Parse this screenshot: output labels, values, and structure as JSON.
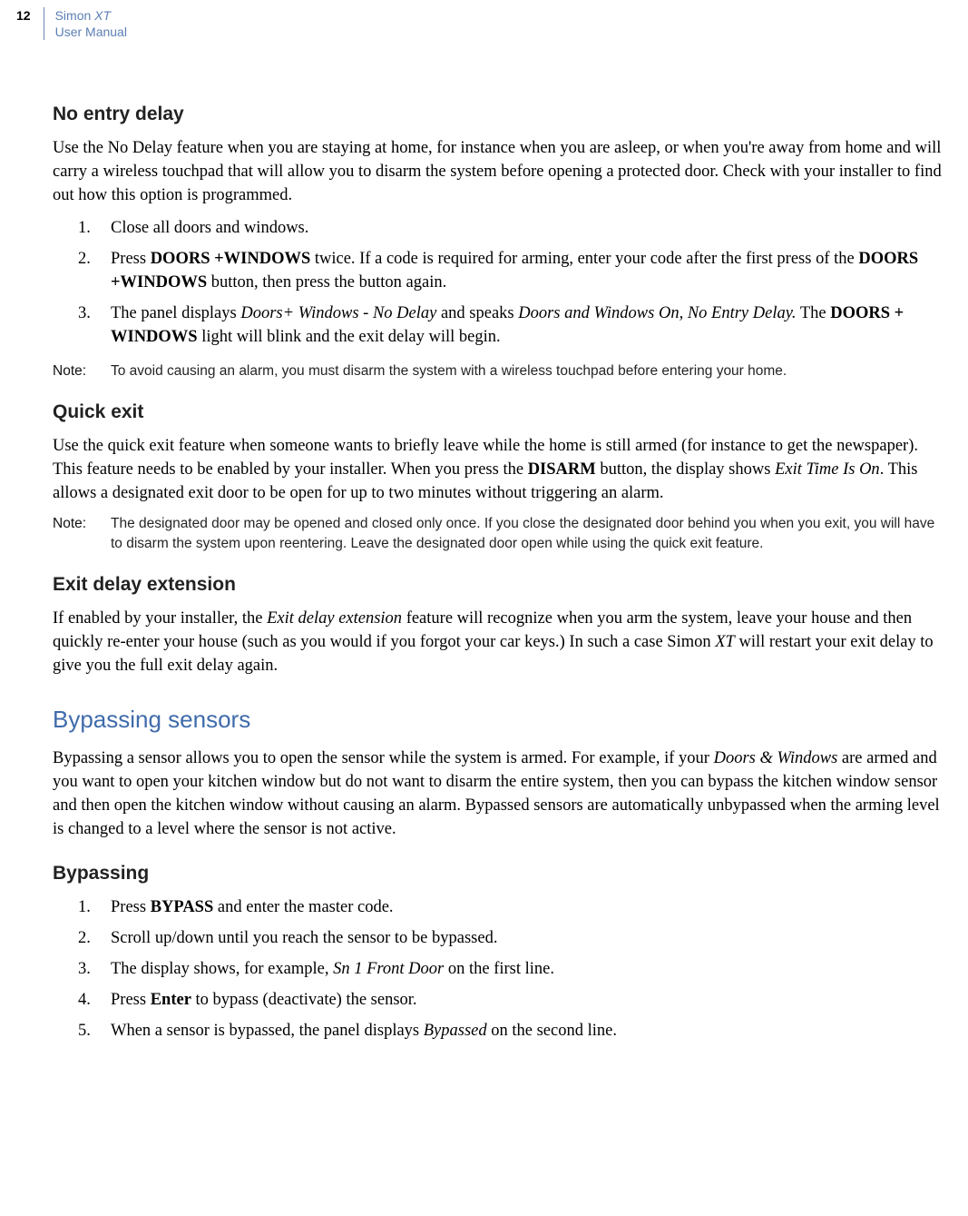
{
  "header": {
    "page_number": "12",
    "title_top": "Simon ",
    "title_top_italic": "XT",
    "title_bottom": "User Manual"
  },
  "sections": {
    "no_entry": {
      "heading": "No entry delay",
      "intro_pre": "Use the No Delay feature when you are staying at home, for instance when you are asleep, or when you're away from home and will carry a wireless touchpad that will allow you to disarm the system before opening a protected door. Check with your installer to find out how this option is programmed.",
      "steps": [
        {
          "n": "1.",
          "pre": "Close all doors and windows."
        },
        {
          "n": "2.",
          "pre": "Press ",
          "b1": "DOORS +WINDOWS",
          "mid": " twice. If a code is required for arming, enter your code after the first press of the ",
          "b2": "DOORS +WINDOWS",
          "post": " button, then press the button again."
        },
        {
          "n": "3.",
          "pre": "The panel displays ",
          "i1": "Doors+ Windows - No Delay",
          "mid1": " and speaks ",
          "i2": "Doors and Windows On, No Entry Delay.",
          "mid2": " The ",
          "b1": "DOORS + WINDOWS",
          "post": " light will blink and the exit delay will begin."
        }
      ],
      "note_label": "Note:",
      "note_text": "To avoid causing an alarm, you must disarm the system with a wireless touchpad before entering your home."
    },
    "quick_exit": {
      "heading": "Quick exit",
      "intro_pre": "Use the quick exit feature when someone wants to briefly leave while the home is still armed (for instance to get the newspaper). This feature needs to be enabled by your installer. When you press the ",
      "intro_b1": "DISARM",
      "intro_mid": " button, the display shows ",
      "intro_i1": "Exit Time Is On",
      "intro_post": ". This allows a designated exit door to be open for up to two minutes without triggering an alarm.",
      "note_label": "Note:",
      "note_text": "The designated door may be opened and closed only once. If you close the designated door behind you when you exit, you will have to disarm the system upon reentering. Leave the designated door open while using the quick exit feature."
    },
    "exit_ext": {
      "heading": "Exit delay extension",
      "p_pre": "If enabled by your installer, the ",
      "p_i1": "Exit delay extension",
      "p_mid": " feature will recognize when you arm the system, leave your house and then quickly re-enter your house (such as you would if you forgot your car keys.) In such a case Simon ",
      "p_i2": "XT",
      "p_post": " will restart your exit delay to give you the full exit delay again."
    },
    "bypassing": {
      "heading": "Bypassing sensors",
      "p_pre": "Bypassing a sensor allows you to open the sensor while the system is armed. For example, if your ",
      "p_i1": "Doors & Windows",
      "p_post": " are armed and you want to open your kitchen window but do not want to disarm the entire system, then you can bypass the kitchen window sensor and then open the kitchen window without causing an alarm. Bypassed sensors are automatically unbypassed when the arming level is changed to a level where the sensor is not active."
    },
    "bypass_steps": {
      "heading": "Bypassing",
      "steps": [
        {
          "n": "1.",
          "pre": "Press ",
          "b1": "BYPASS",
          "post": " and enter the master code."
        },
        {
          "n": "2.",
          "pre": "Scroll up/down until you reach the sensor to be bypassed."
        },
        {
          "n": "3.",
          "pre": "The display shows, for example, ",
          "i1": "Sn 1 Front Door",
          "post": " on the first line."
        },
        {
          "n": "4.",
          "pre": "Press ",
          "b1": "Enter",
          "post": " to bypass (deactivate) the sensor."
        },
        {
          "n": "5.",
          "pre": "When a sensor is bypassed, the panel displays ",
          "i1": "Bypassed",
          "post": " on the second line."
        }
      ]
    }
  }
}
